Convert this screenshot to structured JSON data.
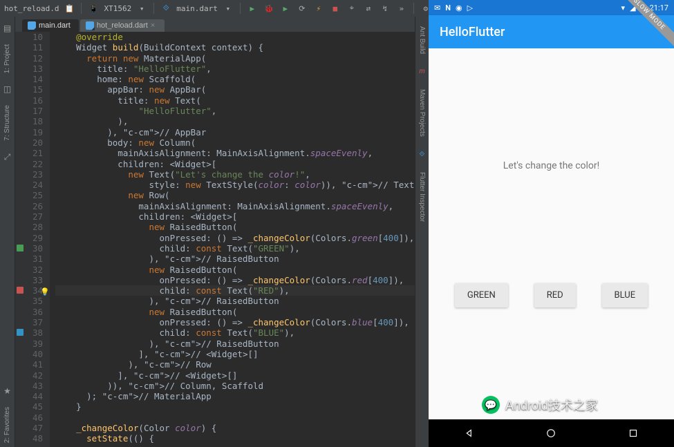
{
  "toolbar": {
    "breadcrumb": "hot_reload.d",
    "paste_icon": "📋",
    "device": "XT1562",
    "run_config": "main.dart",
    "run_icon": "▶",
    "debug_icon": "🐞",
    "profile_icon": "▶",
    "attach_icon": "⟳",
    "hot_reload_icon": "⚡",
    "stop_icon": "■",
    "inspect_icon": "⌖",
    "devtools_icon": "⇄",
    "observe_icon": "↯",
    "more_runs": "»",
    "settings": "⚙"
  },
  "left_tabs": {
    "project": "1: Project",
    "structure": "7: Structure",
    "zoom": "⤢"
  },
  "right_tabs": {
    "ant": "Ant Build",
    "maven": "Maven Projects",
    "maven_icon": "m",
    "flutter": "Flutter Inspector"
  },
  "bottom_tabs": {
    "favorites": "2: Favorites"
  },
  "file_tabs": [
    {
      "name": "main.dart",
      "active": true
    },
    {
      "name": "hot_reload.dart",
      "active": false
    }
  ],
  "editor": {
    "first_line": 10,
    "highlighted_line": 34,
    "markers": [
      {
        "line": 12,
        "type": "bp"
      },
      {
        "line": 30,
        "type": "g"
      },
      {
        "line": 34,
        "type": "br"
      },
      {
        "line": 34,
        "type": "bulb"
      },
      {
        "line": 38,
        "type": "b"
      }
    ],
    "lines": [
      {
        "t": "    @override",
        "indent": 4
      },
      {
        "t": "    Widget build(BuildContext context) {"
      },
      {
        "t": "      return new MaterialApp("
      },
      {
        "t": "        title: \"HelloFlutter\","
      },
      {
        "t": "        home: new Scaffold("
      },
      {
        "t": "          appBar: new AppBar("
      },
      {
        "t": "            title: new Text("
      },
      {
        "t": "                \"HelloFlutter\","
      },
      {
        "t": "            ),"
      },
      {
        "t": "          ), // AppBar"
      },
      {
        "t": "          body: new Column("
      },
      {
        "t": "            mainAxisAlignment: MainAxisAlignment.spaceEvenly,"
      },
      {
        "t": "            children: <Widget>["
      },
      {
        "t": "              new Text(\"Let's change the color!\","
      },
      {
        "t": "                  style: new TextStyle(color: color)), // Text"
      },
      {
        "t": "              new Row("
      },
      {
        "t": "                mainAxisAlignment: MainAxisAlignment.spaceEvenly,"
      },
      {
        "t": "                children: <Widget>["
      },
      {
        "t": "                  new RaisedButton("
      },
      {
        "t": "                    onPressed: () => _changeColor(Colors.green[400]),"
      },
      {
        "t": "                    child: const Text(\"GREEN\"),"
      },
      {
        "t": "                  ), // RaisedButton"
      },
      {
        "t": "                  new RaisedButton("
      },
      {
        "t": "                    onPressed: () => _changeColor(Colors.red[400]),"
      },
      {
        "t": "                    child: const Text(\"RED\"),"
      },
      {
        "t": "                  ), // RaisedButton"
      },
      {
        "t": "                  new RaisedButton("
      },
      {
        "t": "                    onPressed: () => _changeColor(Colors.blue[400]),"
      },
      {
        "t": "                    child: const Text(\"BLUE\"),"
      },
      {
        "t": "                  ), // RaisedButton"
      },
      {
        "t": "                ], // <Widget>[]"
      },
      {
        "t": "              ), // Row"
      },
      {
        "t": "            ], // <Widget>[]"
      },
      {
        "t": "          )), // Column, Scaffold"
      },
      {
        "t": "      ); // MaterialApp"
      },
      {
        "t": "    }"
      },
      {
        "t": ""
      },
      {
        "t": "    _changeColor(Color color) {"
      },
      {
        "t": "      setState(() {"
      }
    ]
  },
  "phone": {
    "status_time": "21:17",
    "app_title": "HelloFlutter",
    "tagline": "Let's change the color!",
    "slow_banner": "SLOW MODE",
    "buttons": [
      "GREEN",
      "RED",
      "BLUE"
    ]
  },
  "watermark": {
    "text": "Android技术之家"
  }
}
